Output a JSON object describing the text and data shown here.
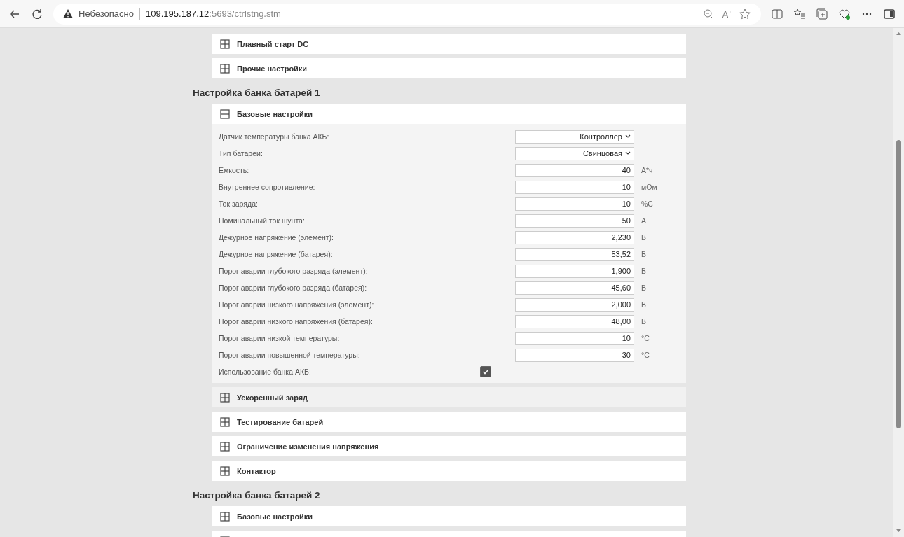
{
  "browser": {
    "security_label": "Небезопасно",
    "url_host": "109.195.187.12",
    "url_path": ":5693/ctrlstng.stm"
  },
  "items": [
    {
      "kind": "panel",
      "title": "Плавный старт DC",
      "expanded": false,
      "highlighted": false
    },
    {
      "kind": "panel",
      "title": "Прочие настройки",
      "expanded": false,
      "highlighted": false
    },
    {
      "kind": "group",
      "title": "Настройка банка батарей 1"
    },
    {
      "kind": "panel",
      "title": "Базовые настройки",
      "expanded": true,
      "highlighted": false,
      "fields": [
        {
          "kind": "select",
          "label": "Датчик температуры банка АКБ:",
          "value": "Контроллер"
        },
        {
          "kind": "select",
          "label": "Тип батареи:",
          "value": "Свинцовая"
        },
        {
          "kind": "number",
          "label": "Емкость:",
          "value": "40",
          "unit": "А*ч"
        },
        {
          "kind": "number",
          "label": "Внутреннее сопротивление:",
          "value": "10",
          "unit": "мОм"
        },
        {
          "kind": "number",
          "label": "Ток заряда:",
          "value": "10",
          "unit": "%С"
        },
        {
          "kind": "number",
          "label": "Номинальный ток шунта:",
          "value": "50",
          "unit": "А"
        },
        {
          "kind": "number",
          "label": "Дежурное напряжение (элемент):",
          "value": "2,230",
          "unit": "В"
        },
        {
          "kind": "number",
          "label": "Дежурное напряжение (батарея):",
          "value": "53,52",
          "unit": "В"
        },
        {
          "kind": "number",
          "label": "Порог аварии глубокого разряда (элемент):",
          "value": "1,900",
          "unit": "В"
        },
        {
          "kind": "number",
          "label": "Порог аварии глубокого разряда (батарея):",
          "value": "45,60",
          "unit": "В"
        },
        {
          "kind": "number",
          "label": "Порог аварии низкого напряжения (элемент):",
          "value": "2,000",
          "unit": "В"
        },
        {
          "kind": "number",
          "label": "Порог аварии низкого напряжения (батарея):",
          "value": "48,00",
          "unit": "В"
        },
        {
          "kind": "number",
          "label": "Порог аварии низкой температуры:",
          "value": "10",
          "unit": "°С"
        },
        {
          "kind": "number",
          "label": "Порог аварии повышенной температуры:",
          "value": "30",
          "unit": "°С"
        },
        {
          "kind": "checkbox",
          "label": "Использование банка АКБ:",
          "checked": true
        }
      ]
    },
    {
      "kind": "panel",
      "title": "Ускоренный заряд",
      "expanded": false,
      "highlighted": true
    },
    {
      "kind": "panel",
      "title": "Тестирование батарей",
      "expanded": false,
      "highlighted": false
    },
    {
      "kind": "panel",
      "title": "Ограничение изменения напряжения",
      "expanded": false,
      "highlighted": false
    },
    {
      "kind": "panel",
      "title": "Контактор",
      "expanded": false,
      "highlighted": false
    },
    {
      "kind": "group",
      "title": "Настройка банка батарей 2"
    },
    {
      "kind": "panel",
      "title": "Базовые настройки",
      "expanded": false,
      "highlighted": false
    },
    {
      "kind": "panel",
      "expanded": false,
      "highlighted": false
    }
  ]
}
